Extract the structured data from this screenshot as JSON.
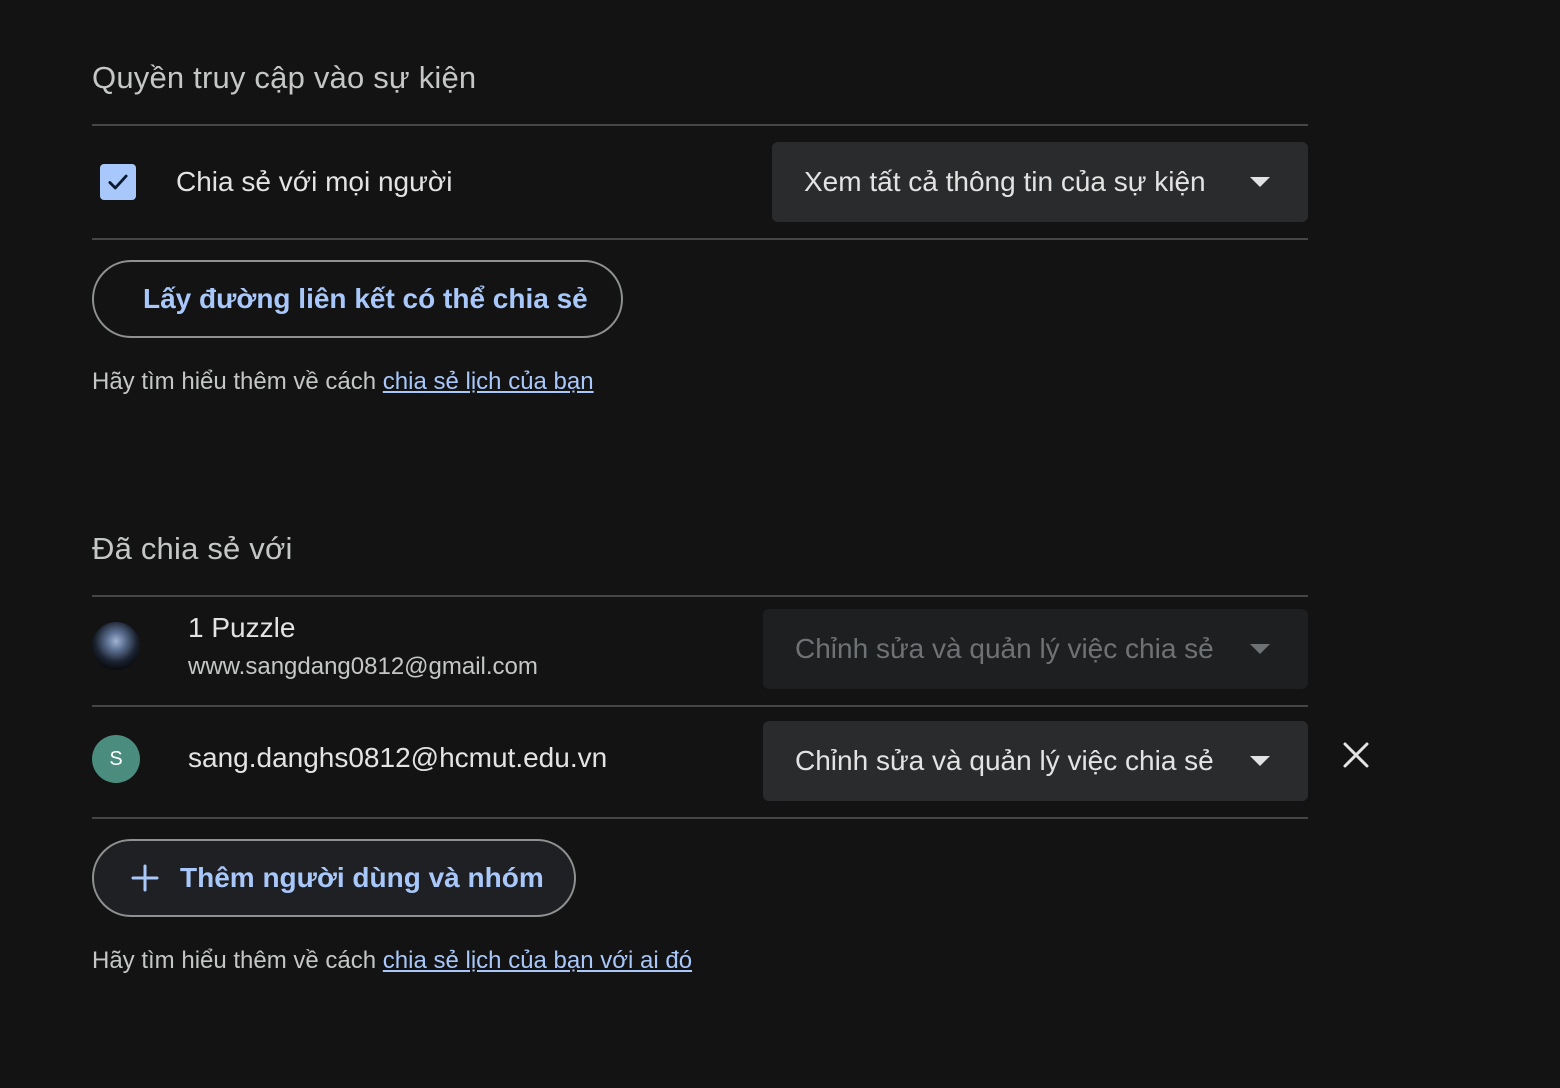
{
  "event_access": {
    "title": "Quyền truy cập vào sự kiện",
    "public_checkbox": {
      "label": "Chia sẻ với mọi người",
      "checked": true
    },
    "permission_select": {
      "value": "Xem tất cả thông tin của sự kiện"
    },
    "get_link_button": "Lấy đường liên kết có thể chia sẻ",
    "help_text": "Hãy tìm hiểu thêm về cách ",
    "help_link": "chia sẻ lịch của bạn"
  },
  "shared_with": {
    "title": "Đã chia sẻ với",
    "people": [
      {
        "name": "1 Puzzle",
        "email": "www.sangdang0812@gmail.com",
        "permission": "Chỉnh sửa và quản lý việc chia sẻ",
        "disabled": true,
        "avatar": "photo"
      },
      {
        "name": "sang.danghs0812@hcmut.edu.vn",
        "avatar_letter": "S",
        "avatar_color": "#4a8c7d",
        "permission": "Chỉnh sửa và quản lý việc chia sẻ",
        "disabled": false,
        "removable": true
      }
    ],
    "add_button": "Thêm người dùng và nhóm",
    "help_text": "Hãy tìm hiểu thêm về cách ",
    "help_link": "chia sẻ lịch của bạn với ai đó"
  },
  "colors": {
    "background": "#131314",
    "accent": "#a8c7fa",
    "divider": "#444746"
  }
}
